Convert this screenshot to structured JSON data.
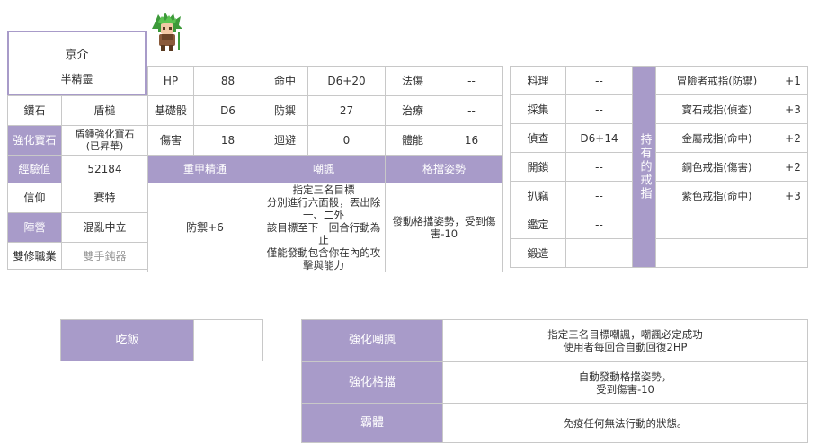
{
  "character": {
    "name": "京介",
    "race": "半精靈"
  },
  "left_info": [
    {
      "label": "鑽石",
      "value": "盾槌",
      "label_style": "plain",
      "value_style": "plain"
    },
    {
      "label": "強化寶石",
      "value": "盾鍾強化寶石\n(已昇華)",
      "label_style": "lav",
      "value_style": "plain"
    },
    {
      "label": "經驗值",
      "value": "52184",
      "label_style": "lav",
      "value_style": "plain"
    },
    {
      "label": "信仰",
      "value": "賽特",
      "label_style": "plain",
      "value_style": "plain"
    },
    {
      "label": "陣營",
      "value": "混亂中立",
      "label_style": "lav",
      "value_style": "plain"
    },
    {
      "label": "雙修職業",
      "value": "雙手鈍器",
      "label_style": "plain",
      "value_style": "gray"
    }
  ],
  "stats": [
    [
      {
        "label": "HP",
        "value": "88"
      },
      {
        "label": "命中",
        "value": "D6+20"
      },
      {
        "label": "法傷",
        "value": "--"
      }
    ],
    [
      {
        "label": "基礎骰",
        "value": "D6"
      },
      {
        "label": "防禦",
        "value": "27"
      },
      {
        "label": "治療",
        "value": "--"
      }
    ],
    [
      {
        "label": "傷害",
        "value": "18"
      },
      {
        "label": "迴避",
        "value": "0"
      },
      {
        "label": "體能",
        "value": "16"
      }
    ]
  ],
  "skills": [
    {
      "name": "重甲精通",
      "desc": "防禦+6"
    },
    {
      "name": "嘲諷",
      "desc": "指定三名目標\n分別進行六面骰，丟出除一、二外\n該目標至下一回合行動為止\n僅能發動包含你在內的攻擊與能力"
    },
    {
      "name": "格擋姿勢",
      "desc": "發動格擋姿勢，受到傷害-10"
    }
  ],
  "life_skills": [
    {
      "label": "料理",
      "value": "--"
    },
    {
      "label": "採集",
      "value": "--"
    },
    {
      "label": "偵查",
      "value": "D6+14"
    },
    {
      "label": "開鎖",
      "value": "--"
    },
    {
      "label": "扒竊",
      "value": "--"
    },
    {
      "label": "鑑定",
      "value": "--"
    },
    {
      "label": "鍛造",
      "value": "--"
    }
  ],
  "rings": {
    "header": "持有的戒指",
    "items": [
      {
        "name": "冒險者戒指(防禦)",
        "bonus": "+1"
      },
      {
        "name": "寶石戒指(偵查)",
        "bonus": "+3"
      },
      {
        "name": "金屬戒指(命中)",
        "bonus": "+2"
      },
      {
        "name": "銅色戒指(傷害)",
        "bonus": "+2"
      },
      {
        "name": "紫色戒指(命中)",
        "bonus": "+3"
      },
      {
        "name": "",
        "bonus": ""
      },
      {
        "name": "",
        "bonus": ""
      }
    ]
  },
  "food": {
    "label": "吃飯",
    "value": ""
  },
  "enhanced_skills": [
    {
      "name": "強化嘲諷",
      "desc": "指定三名目標嘲諷，嘲諷必定成功\n使用者每回合自動回復2HP"
    },
    {
      "name": "強化格擋",
      "desc": "自動發動格擋姿勢，\n受到傷害-10"
    },
    {
      "name": "霸體",
      "desc": "免疫任何無法行動的狀態。"
    }
  ],
  "colors": {
    "accent": "#a89bc9",
    "border": "#c8c8c8",
    "hair": "#4caf50"
  },
  "icons": {
    "avatar": "character-sprite"
  }
}
